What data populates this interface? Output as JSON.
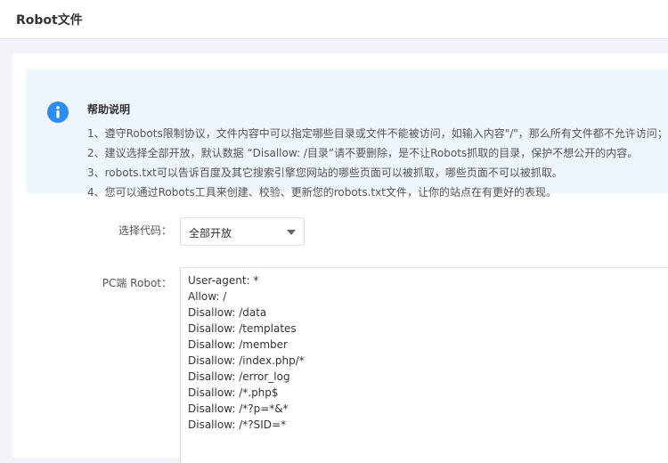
{
  "page": {
    "title": "Robot文件"
  },
  "help": {
    "title": "帮助说明",
    "lines": [
      "1、遵守Robots限制协议，文件内容中可以指定哪些目录或文件不能被访问，如输入内容\"/\"，那么所有文件都不允许访问；",
      "2、建议选择全部开放，默认数据 “Disallow: /目录”请不要删除，是不让Robots抓取的目录，保护不想公开的内容。",
      "3、robots.txt可以告诉百度及其它搜索引擎您网站的哪些页面可以被抓取，哪些页面不可以被抓取。",
      "4、您可以通过Robots工具来创建、校验、更新您的robots.txt文件，让你的站点在有更好的表现。"
    ]
  },
  "form": {
    "code_label": "选择代码：",
    "code_selected": "全部开放",
    "pc_label": "PC端 Robot：",
    "pc_robot_lines": [
      "User-agent: *",
      "Allow: /",
      "Disallow: /data",
      "Disallow: /templates",
      "Disallow: /member",
      "Disallow: /index.php/*",
      "Disallow: /error_log",
      "Disallow: /*.php$",
      "Disallow: /*?p=*&*",
      "Disallow: /*?SID=*"
    ]
  },
  "colors": {
    "accent": "#2d8cf0",
    "help_bg": "#eef6fd"
  }
}
